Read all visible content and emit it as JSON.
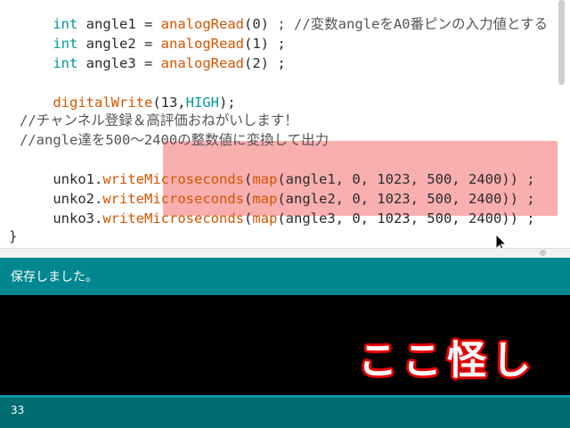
{
  "editor": {
    "lines": [
      {
        "type": "var",
        "kw": "int",
        "name": "angle1",
        "fn": "analogRead",
        "arg": "(0)",
        "tail": " ; //変数angleをA0番ピンの入力値とする"
      },
      {
        "type": "var",
        "kw": "int",
        "name": "angle2",
        "fn": "analogRead",
        "arg": "(1)",
        "tail": " ;"
      },
      {
        "type": "var",
        "kw": "int",
        "name": "angle3",
        "fn": "analogRead",
        "arg": "(2)",
        "tail": " ;"
      },
      {
        "type": "dw",
        "fn": "digitalWrite",
        "pre": "(13,",
        "kw": "HIGH",
        "post": ");"
      },
      {
        "type": "comment",
        "text": "//チャンネル登録＆高評価おねがいします！"
      },
      {
        "type": "comment",
        "text": "//angle達を500〜2400の整数値に変換して出力"
      },
      {
        "type": "call",
        "obj": "unko1",
        "method": "writeMicroseconds",
        "fn": "map",
        "args": "(angle1, 0, 1023, 500, 2400)) ;"
      },
      {
        "type": "call",
        "obj": "unko2",
        "method": "writeMicroseconds",
        "fn": "map",
        "args": "(angle2, 0, 1023, 500, 2400)) ;"
      },
      {
        "type": "call",
        "obj": "unko3",
        "method": "writeMicroseconds",
        "fn": "map",
        "args": "(angle3, 0, 1023, 500, 2400)) ;"
      },
      {
        "type": "brace",
        "text": "}"
      }
    ]
  },
  "status": {
    "message": "保存しました。"
  },
  "subtitle": {
    "text": "ここ怪し"
  },
  "footer": {
    "line_number": "33"
  },
  "colors": {
    "keyword": "#00979c",
    "function": "#d35400",
    "status_bar": "#00878f",
    "highlight": "#f9a6a6"
  }
}
